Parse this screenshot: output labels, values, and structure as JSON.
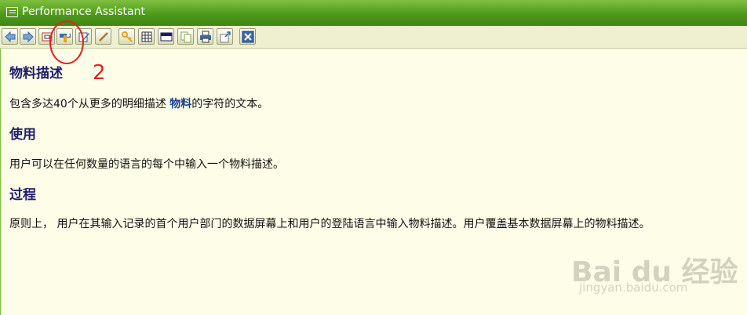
{
  "window": {
    "title": "Performance Assistant"
  },
  "toolbar": {
    "buttons": [
      {
        "name": "back-button",
        "icon": "arrow-left-icon"
      },
      {
        "name": "forward-button",
        "icon": "arrow-right-icon"
      },
      {
        "name": "display-button",
        "icon": "document-frame-icon"
      },
      {
        "name": "technical-info-button",
        "icon": "tools-icon"
      },
      {
        "name": "edit-button",
        "icon": "pencil-icon"
      },
      {
        "name": "link-button",
        "icon": "link-icon"
      },
      {
        "name": "key-button",
        "icon": "key-icon"
      },
      {
        "name": "table-button",
        "icon": "table-icon"
      },
      {
        "name": "window-button",
        "icon": "window-icon"
      },
      {
        "name": "copy-button",
        "icon": "copy-icon"
      },
      {
        "name": "print-button",
        "icon": "printer-icon"
      },
      {
        "name": "export-button",
        "icon": "export-icon"
      },
      {
        "name": "close-button",
        "icon": "close-icon"
      }
    ]
  },
  "content": {
    "section1": {
      "heading": "物料描述",
      "text_before": "包含多达40个从更多的明细描述 ",
      "link": "物料",
      "text_after": "的字符的文本。"
    },
    "section2": {
      "heading": "使用",
      "text": "用户可以在任何数量的语言的每个中输入一个物料描述。"
    },
    "section3": {
      "heading": "过程",
      "text": "原则上， 用户在其输入记录的首个用户部门的数据屏幕上和用户的登陆语言中输入物料描述。用户覆盖基本数据屏幕上的物料描述。"
    }
  },
  "annotation": {
    "label": "2",
    "color": "#e02222"
  },
  "watermark": {
    "brand": "Bai du 经验",
    "url": "jingyan.baidu.com"
  },
  "colors": {
    "titlebar": "#4f9a1c",
    "background": "#fdfde8",
    "heading": "#1d1d6b"
  }
}
